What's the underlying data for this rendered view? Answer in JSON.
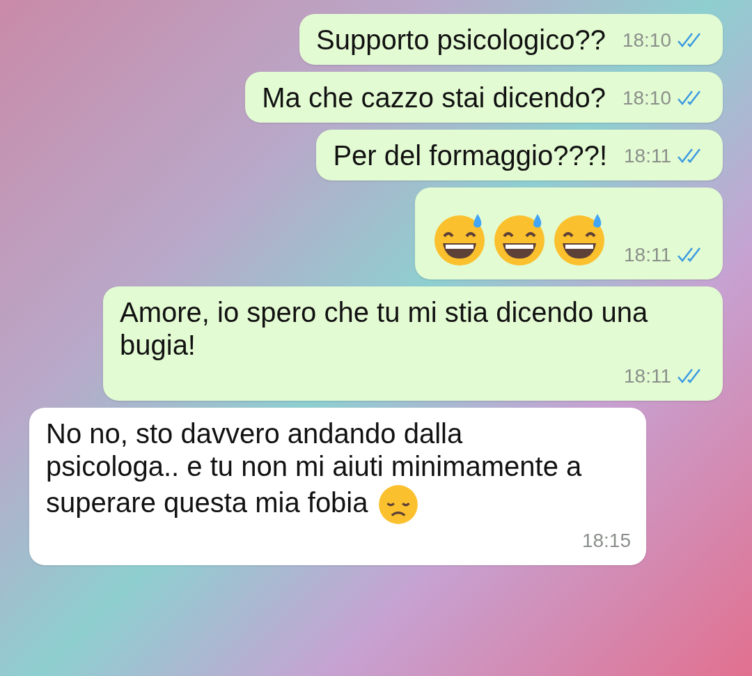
{
  "messages": [
    {
      "kind": "text",
      "outgoing": true,
      "text": "Supporto psicologico??",
      "time": "18:10",
      "read": true
    },
    {
      "kind": "text",
      "outgoing": true,
      "text": "Ma che cazzo stai dicendo?",
      "time": "18:10",
      "read": true
    },
    {
      "kind": "text",
      "outgoing": true,
      "text": "Per del formaggio???!",
      "time": "18:11",
      "read": true
    },
    {
      "kind": "emoji",
      "outgoing": true,
      "emojis": [
        {
          "kind": "grin_sweat"
        },
        {
          "kind": "grin_sweat"
        },
        {
          "kind": "grin_sweat"
        }
      ],
      "time": "18:11",
      "read": true
    },
    {
      "kind": "text",
      "outgoing": true,
      "text": "Amore, io spero che tu mi stia dicendo una bugia!",
      "time": "18:11",
      "read": true
    },
    {
      "kind": "text",
      "outgoing": false,
      "text": "No no, sto davvero andando dalla psicologa.. e tu non mi aiuti minimamente a superare questa mia fobia",
      "trailing_emoji": {
        "kind": "sad"
      },
      "time": "18:15"
    }
  ]
}
